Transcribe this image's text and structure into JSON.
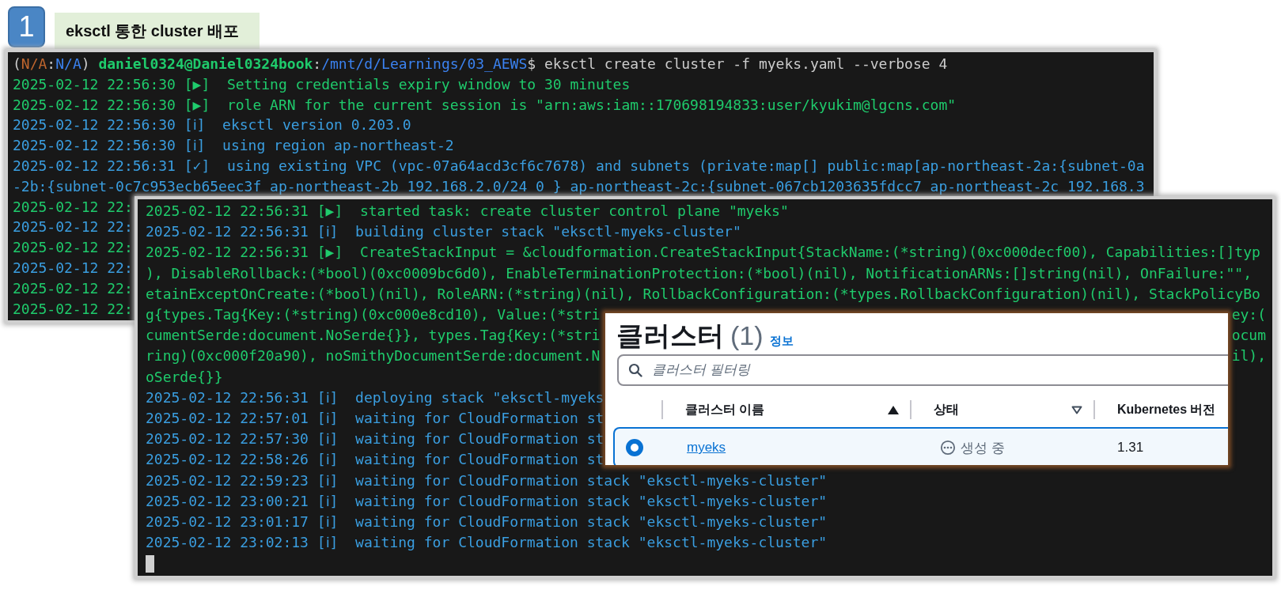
{
  "heading": {
    "number": "1",
    "title": "eksctl 통한 cluster 배포"
  },
  "terminals": [
    {
      "prompt": [
        {
          "text": "(",
          "kind": "plain"
        },
        {
          "text": "N/A",
          "kind": "context"
        },
        {
          "text": ":",
          "kind": "plain"
        },
        {
          "text": "N/A",
          "kind": "path"
        },
        {
          "text": ") ",
          "kind": "plain"
        },
        {
          "text": "daniel0324@Daniel0324book",
          "kind": "user"
        },
        {
          "text": ":",
          "kind": "plain"
        },
        {
          "text": "/mnt/d/Learnings/03_AEWS",
          "kind": "path"
        },
        {
          "text": "$ eksctl create cluster -f myeks.yaml --verbose 4",
          "kind": "plain"
        }
      ],
      "lines": [
        {
          "text": "2025-02-12 22:56:30 [▶]  Setting credentials expiry window to 30 minutes",
          "kind": "task"
        },
        {
          "text": "2025-02-12 22:56:30 [▶]  role ARN for the current session is \"arn:aws:iam::170698194833:user/kyukim@lgcns.com\"",
          "kind": "task"
        },
        {
          "text": "2025-02-12 22:56:30 [ℹ]  eksctl version 0.203.0",
          "kind": "info"
        },
        {
          "text": "2025-02-12 22:56:30 [ℹ]  using region ap-northeast-2",
          "kind": "info"
        },
        {
          "text": "2025-02-12 22:56:31 [✓]  using existing VPC (vpc-07a64acd3cf6c7678) and subnets (private:map[] public:map[ap-northeast-2a:{subnet-0a",
          "kind": "info"
        },
        {
          "text": "-2b:{subnet-0c7c953ecb65eec3f ap-northeast-2b 192.168.2.0/24 0 } ap-northeast-2c:{subnet-067cb1203635fdcc7 ap-northeast-2c 192.168.3",
          "kind": "info"
        },
        {
          "text": "2025-02-12 22:",
          "kind": "task"
        },
        {
          "text": "2025-02-12 22:",
          "kind": "info"
        },
        {
          "text": "2025-02-12 22:",
          "kind": "task"
        },
        {
          "text": "2025-02-12 22:",
          "kind": "info"
        },
        {
          "text": "2025-02-12 22:",
          "kind": "task"
        },
        {
          "text": "2025-02-12 22:",
          "kind": "task"
        }
      ]
    },
    {
      "lines": [
        {
          "text": "2025-02-12 22:56:31 [▶]  started task: create cluster control plane \"myeks\"",
          "kind": "task"
        },
        {
          "text": "2025-02-12 22:56:31 [ℹ]  building cluster stack \"eksctl-myeks-cluster\"",
          "kind": "info"
        },
        {
          "text": "2025-02-12 22:56:31 [▶]  CreateStackInput = &cloudformation.CreateStackInput{StackName:(*string)(0xc000decf00), Capabilities:[]typ",
          "kind": "task"
        },
        {
          "text": "), DisableRollback:(*bool)(0xc0009bc6d0), EnableTerminationProtection:(*bool)(nil), NotificationARNs:[]string(nil), OnFailure:\"\",",
          "kind": "task"
        },
        {
          "text": "etainExceptOnCreate:(*bool)(nil), RoleARN:(*string)(nil), RollbackConfiguration:(*types.RollbackConfiguration)(nil), StackPolicyBo",
          "kind": "task"
        },
        {
          "text": "g{types.Tag{Key:(*string)(0xc000e8cd10), Value:(*stri",
          "tail": "ey:(",
          "kind": "task"
        },
        {
          "text": "cumentSerde:document.NoSerde{}}, types.Tag{Key:(*stri",
          "tail": "ocum",
          "kind": "task"
        },
        {
          "text": "ring)(0xc000f20a90), noSmithyDocumentSerde:document.N",
          "tail": "il),",
          "kind": "task"
        },
        {
          "text": "oSerde{}}",
          "kind": "task"
        },
        {
          "text": "2025-02-12 22:56:31 [ℹ]  deploying stack \"eksctl-myeks",
          "kind": "info"
        },
        {
          "text": "2025-02-12 22:57:01 [ℹ]  waiting for CloudFormation st",
          "kind": "info"
        },
        {
          "text": "2025-02-12 22:57:30 [ℹ]  waiting for CloudFormation st",
          "kind": "info"
        },
        {
          "text": "2025-02-12 22:58:26 [ℹ]  waiting for CloudFormation st",
          "kind": "info"
        },
        {
          "text": "2025-02-12 22:59:23 [ℹ]  waiting for CloudFormation stack \"eksctl-myeks-cluster\"",
          "kind": "info"
        },
        {
          "text": "2025-02-12 23:00:21 [ℹ]  waiting for CloudFormation stack \"eksctl-myeks-cluster\"",
          "kind": "info"
        },
        {
          "text": "2025-02-12 23:01:17 [ℹ]  waiting for CloudFormation stack \"eksctl-myeks-cluster\"",
          "kind": "info"
        },
        {
          "text": "2025-02-12 23:02:13 [ℹ]  waiting for CloudFormation stack \"eksctl-myeks-cluster\"",
          "kind": "info"
        }
      ],
      "cursor": true
    }
  ],
  "cluster_panel": {
    "title": "클러스터",
    "count": "(1)",
    "info_link": "정보",
    "search": {
      "placeholder": "클러스터 필터링"
    },
    "columns": [
      {
        "label": "클러스터 이름",
        "sorted": true
      },
      {
        "label": "상태",
        "sorted": false
      },
      {
        "label": "Kubernetes 버전"
      }
    ],
    "rows": [
      {
        "selected": true,
        "name": "myeks",
        "status": "생성 중",
        "version": "1.31"
      }
    ]
  }
}
